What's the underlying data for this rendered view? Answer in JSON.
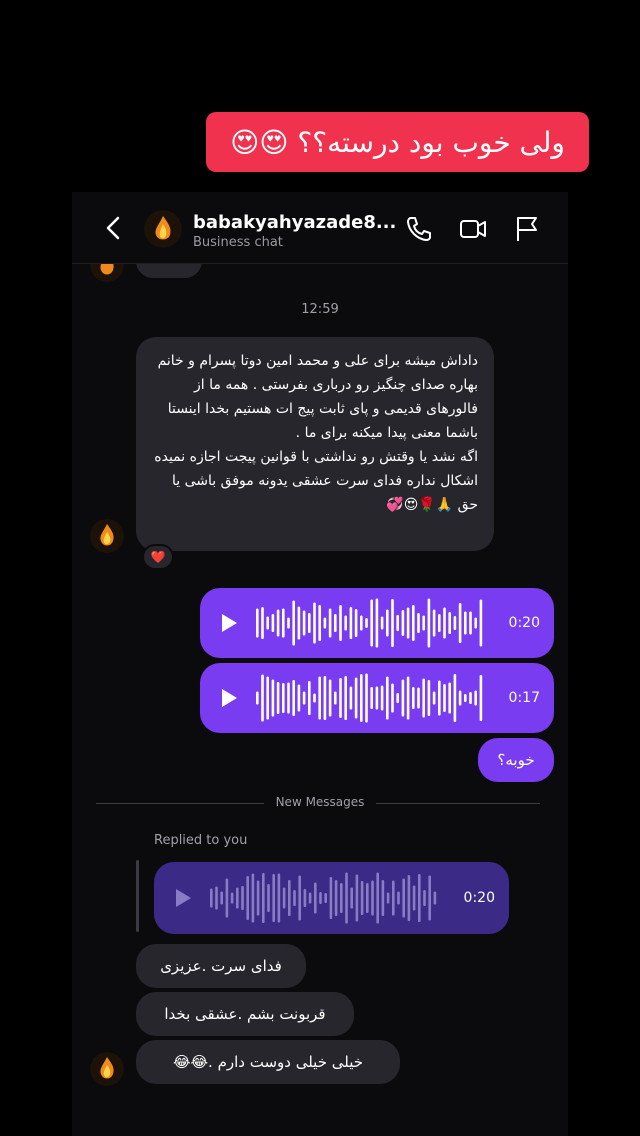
{
  "story_caption": "ولی خوب بود درسته؟؟ 😍😍",
  "header": {
    "name": "babakyahyazade8...",
    "subtitle": "Business chat",
    "icons": [
      "back-chevron-icon",
      "phone-icon",
      "video-icon",
      "flag-icon"
    ]
  },
  "timestamp": "12:59",
  "incoming_long": "داداش میشه برای علی و محمد امین دوتا پسرام و خانم بهاره  صدای چنگیز رو درباری بفرستی . همه ما از فالورهای قدیمی و پای ثابت پیج ات هستیم بخدا اینستا باشما معنی پیدا میکنه برای ما .\nاگه نشد یا وقتش رو نداشتی با قوانین پیجت اجازه نمیده اشکال  نداره  فدای سرت عشقی یدونه موفق باشی یا حق 🙏🌹😍💞",
  "reaction": "❤️",
  "voice_messages": [
    {
      "duration": "0:20"
    },
    {
      "duration": "0:17"
    }
  ],
  "outgoing_text": "خوبه؟",
  "divider": "New Messages",
  "replied_label": "Replied to you",
  "replied_voice_duration": "0:20",
  "incoming_short": [
    "فدای سرت .عزیزی",
    "قربونت بشم .عشقی بخدا",
    "خیلی خیلی دوست دارم .😂😂"
  ],
  "colors": {
    "caption_bg": "#f0324f",
    "outgoing_bubble": "#7a3cf0",
    "replied_voice_bg": "#3b2a86",
    "incoming_bubble": "#26262c",
    "background": "#000000"
  }
}
